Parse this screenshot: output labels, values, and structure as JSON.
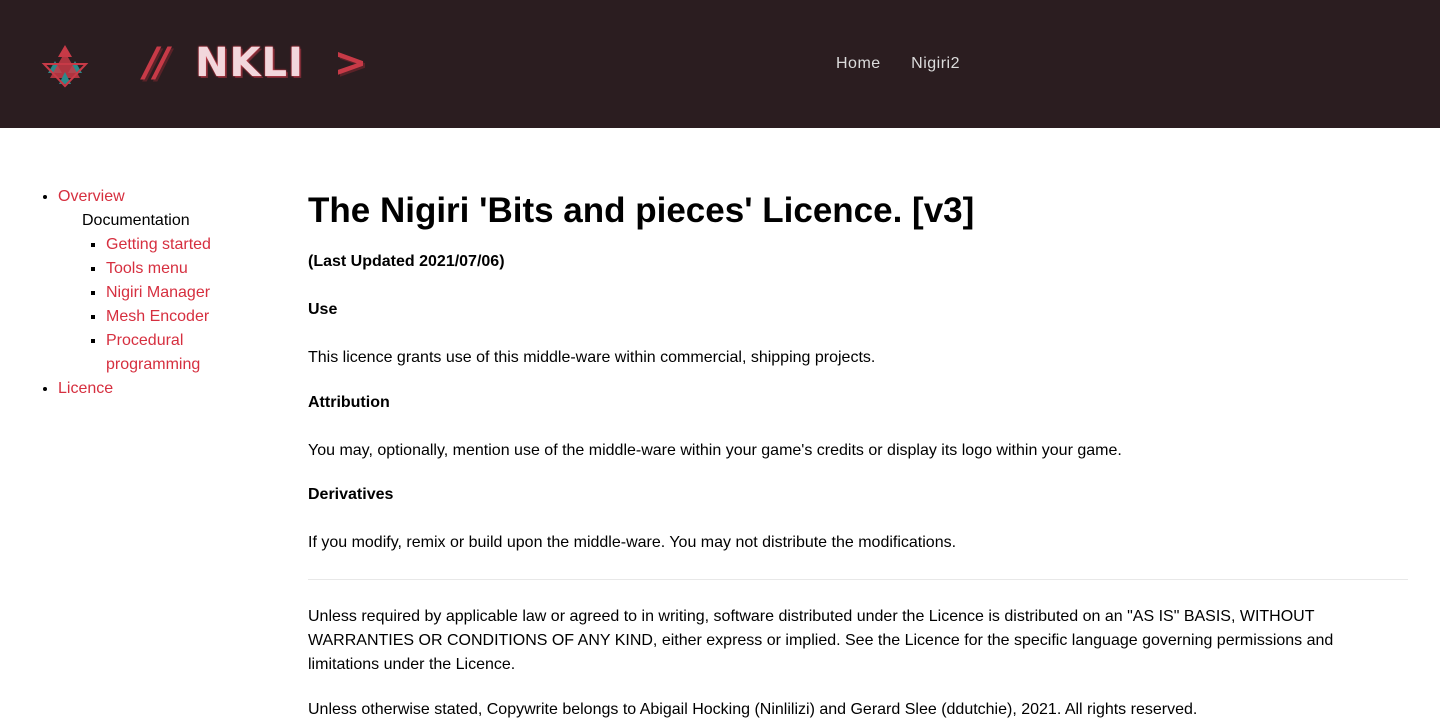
{
  "header": {
    "logo": {
      "slashes": "//",
      "name": "NKLI",
      "caret": ">",
      "icon": "triforce-logo-icon",
      "colors": {
        "red": "#c73a47",
        "teal": "#2a8a8a",
        "text": "#f2d7dc"
      }
    },
    "nav": [
      {
        "label": "Home"
      },
      {
        "label": "Nigiri2"
      }
    ],
    "background": "#2b1d20"
  },
  "sidebar": {
    "items": [
      {
        "label": "Overview"
      },
      {
        "label": "Documentation"
      },
      {
        "label": "Getting started"
      },
      {
        "label": "Tools menu"
      },
      {
        "label": "Nigiri Manager"
      },
      {
        "label": "Mesh Encoder"
      },
      {
        "label": "Procedural programming"
      },
      {
        "label": "Licence"
      }
    ],
    "link_color": "#d62f3f"
  },
  "main": {
    "title": "The Nigiri 'Bits and pieces' Licence. [v3]",
    "updated": "(Last Updated 2021/07/06)",
    "sections": [
      {
        "heading": "Use",
        "text": "This licence grants use of this middle-ware within commercial, shipping projects."
      },
      {
        "heading": "Attribution",
        "text": "You may, optionally, mention use of the middle-ware within your game's credits or display its logo within your game."
      },
      {
        "heading": "Derivatives",
        "text": "If you modify, remix or build upon the middle-ware. You may not distribute the modifications."
      }
    ],
    "disclaimer": "Unless required by applicable law or agreed to in writing, software distributed under the Licence is distributed on an \"AS IS\" BASIS, WITHOUT WARRANTIES OR CONDITIONS OF ANY KIND, either express or implied. See the Licence for the specific language governing permissions and limitations under the Licence.",
    "copyright": "Unless otherwise stated, Copywrite belongs to Abigail Hocking (Ninlilizi) and Gerard Slee (ddutchie), 2021. All rights reserved."
  }
}
